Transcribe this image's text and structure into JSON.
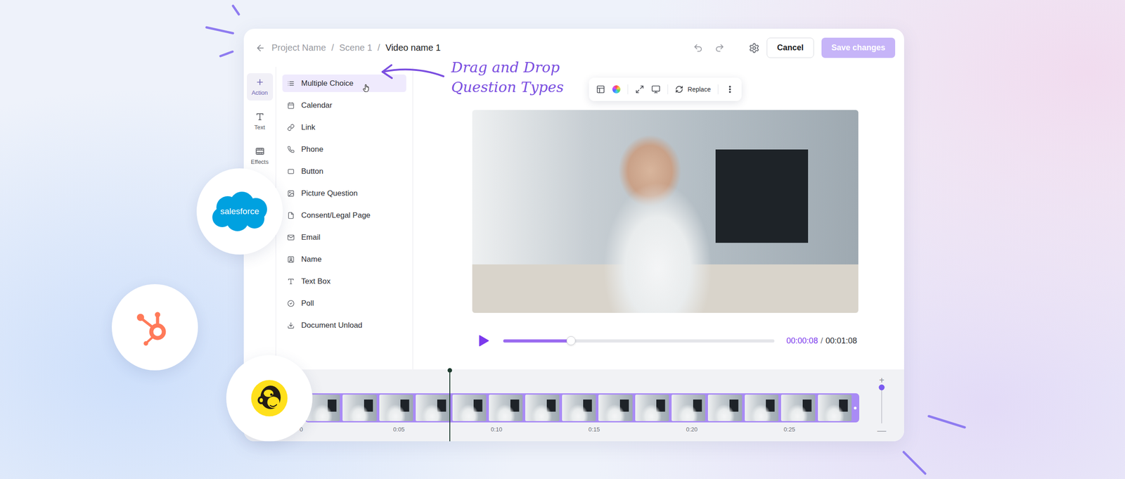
{
  "breadcrumb": {
    "items": [
      {
        "label": "Project Name",
        "current": false
      },
      {
        "label": "Scene 1",
        "current": false
      },
      {
        "label": "Video name 1",
        "current": true
      }
    ],
    "separator": "/"
  },
  "header": {
    "cancel": "Cancel",
    "save": {
      "label": "Save changes",
      "disabled": true
    }
  },
  "rail": [
    {
      "label": "Action",
      "selected": true
    },
    {
      "label": "Text",
      "selected": false
    },
    {
      "label": "Effects",
      "selected": false
    }
  ],
  "question_types": [
    {
      "label": "Multiple Choice",
      "selected": true
    },
    {
      "label": "Calendar",
      "selected": false
    },
    {
      "label": "Link",
      "selected": false
    },
    {
      "label": "Phone",
      "selected": false
    },
    {
      "label": "Button",
      "selected": false
    },
    {
      "label": "Picture Question",
      "selected": false
    },
    {
      "label": "Consent/Legal Page",
      "selected": false
    },
    {
      "label": "Email",
      "selected": false
    },
    {
      "label": "Name",
      "selected": false
    },
    {
      "label": "Text Box",
      "selected": false
    },
    {
      "label": "Poll",
      "selected": false
    },
    {
      "label": "Document Unload",
      "selected": false
    }
  ],
  "annotation": [
    "Drag and Drop",
    "Question Types"
  ],
  "toolbar": {
    "replace": "Replace"
  },
  "player": {
    "playing": false,
    "level": 0.25,
    "elapsed": "00:00:08",
    "separator": "/",
    "total": "00:01:08"
  },
  "timeline": {
    "ticks": [
      "0",
      "0:05",
      "0:10",
      "0:15",
      "0:20",
      "0:25"
    ],
    "playhead_level": 0.26,
    "zoom": {
      "plus": "+",
      "minus": "—",
      "level": 1
    }
  },
  "integrations": [
    {
      "kind": "salesforce",
      "label": "salesforce"
    },
    {
      "kind": "hubspot"
    },
    {
      "kind": "mailchimp"
    }
  ]
}
